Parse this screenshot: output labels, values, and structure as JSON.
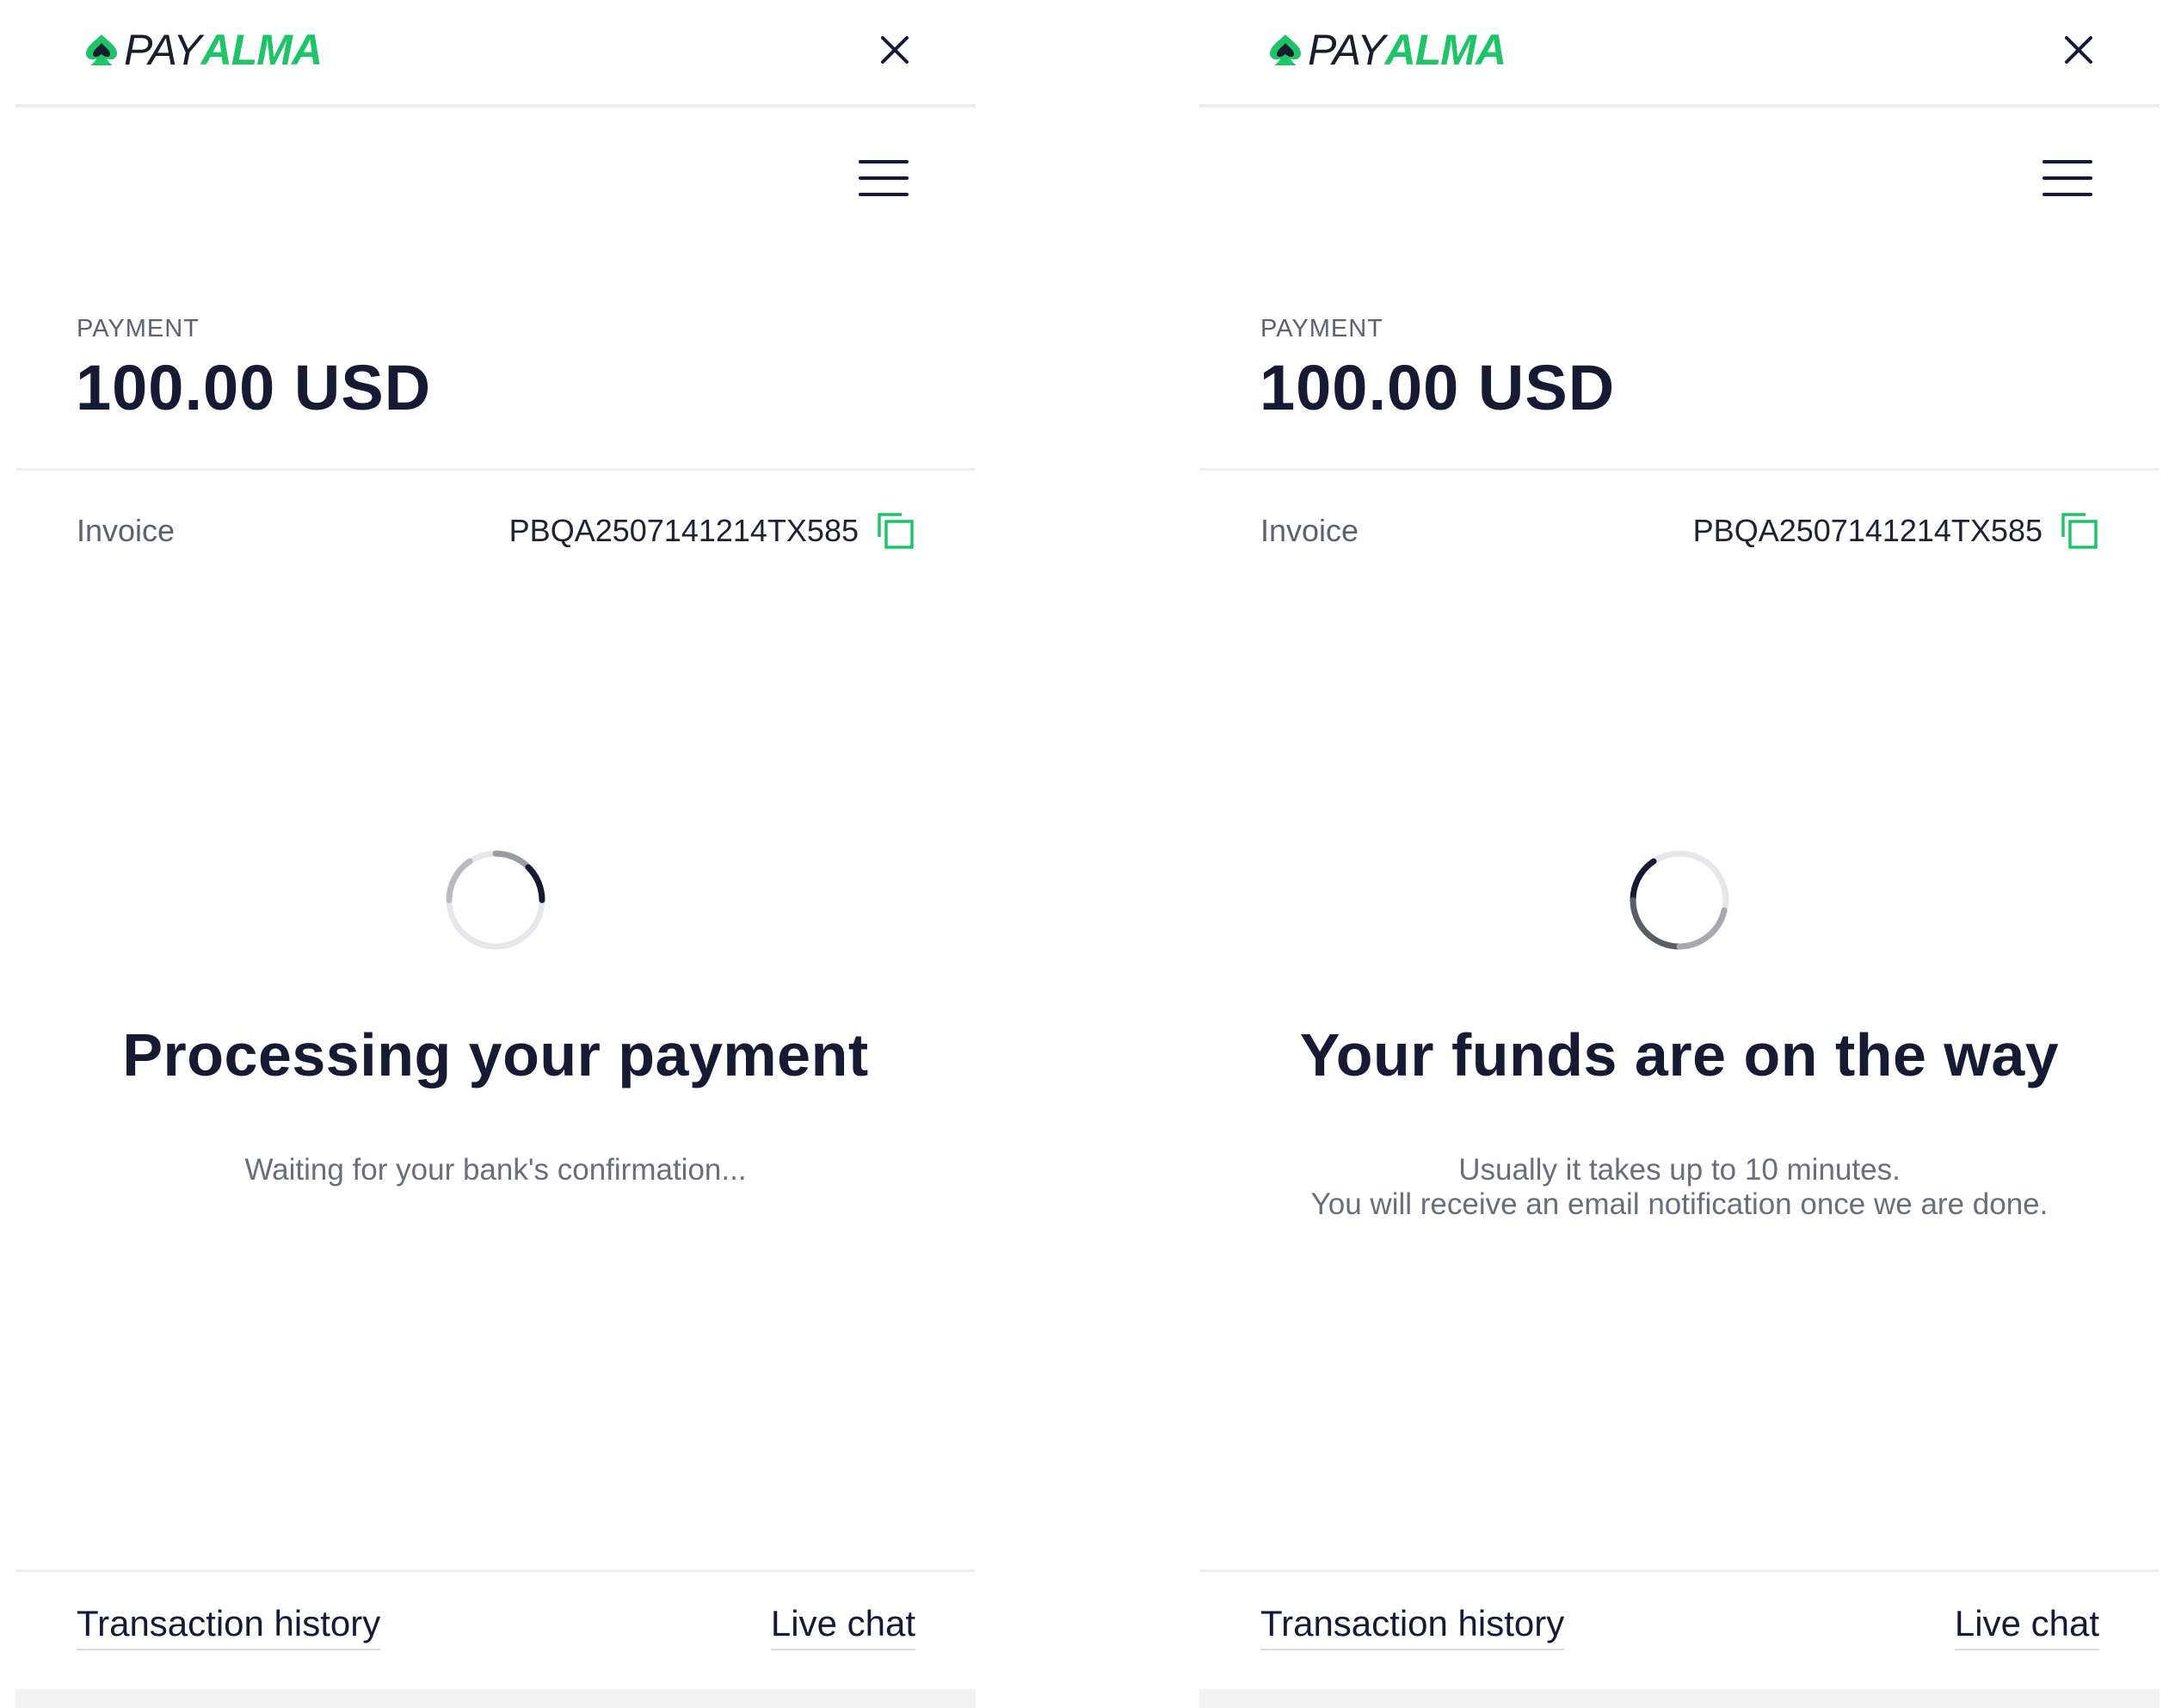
{
  "panels": [
    {
      "brand": {
        "pay": "PAY",
        "alma": "ALMA"
      },
      "menu_icon": "hamburger-menu-icon",
      "close_icon": "close-icon",
      "payment": {
        "label": "PAYMENT",
        "amount": "100.00 USD"
      },
      "invoice": {
        "label": "Invoice",
        "value": "PBQA2507141214TX585",
        "copy_icon": "copy-icon"
      },
      "status": {
        "title": "Processing your payment",
        "lines": [
          "Waiting for your bank's confirmation..."
        ]
      },
      "footer": {
        "history": "Transaction history",
        "chat": "Live chat"
      }
    },
    {
      "brand": {
        "pay": "PAY",
        "alma": "ALMA"
      },
      "menu_icon": "hamburger-menu-icon",
      "close_icon": "close-icon",
      "payment": {
        "label": "PAYMENT",
        "amount": "100.00 USD"
      },
      "invoice": {
        "label": "Invoice",
        "value": "PBQA2507141214TX585",
        "copy_icon": "copy-icon"
      },
      "status": {
        "title": "Your funds are on the way",
        "lines": [
          "Usually it takes up to 10 minutes.",
          "You will receive an email notification once we are done."
        ]
      },
      "footer": {
        "history": "Transaction history",
        "chat": "Live chat"
      }
    }
  ],
  "colors": {
    "brand_green": "#1fc468",
    "text_dark": "#161a33",
    "text_muted": "#5d6170",
    "divider": "#eceef1"
  }
}
